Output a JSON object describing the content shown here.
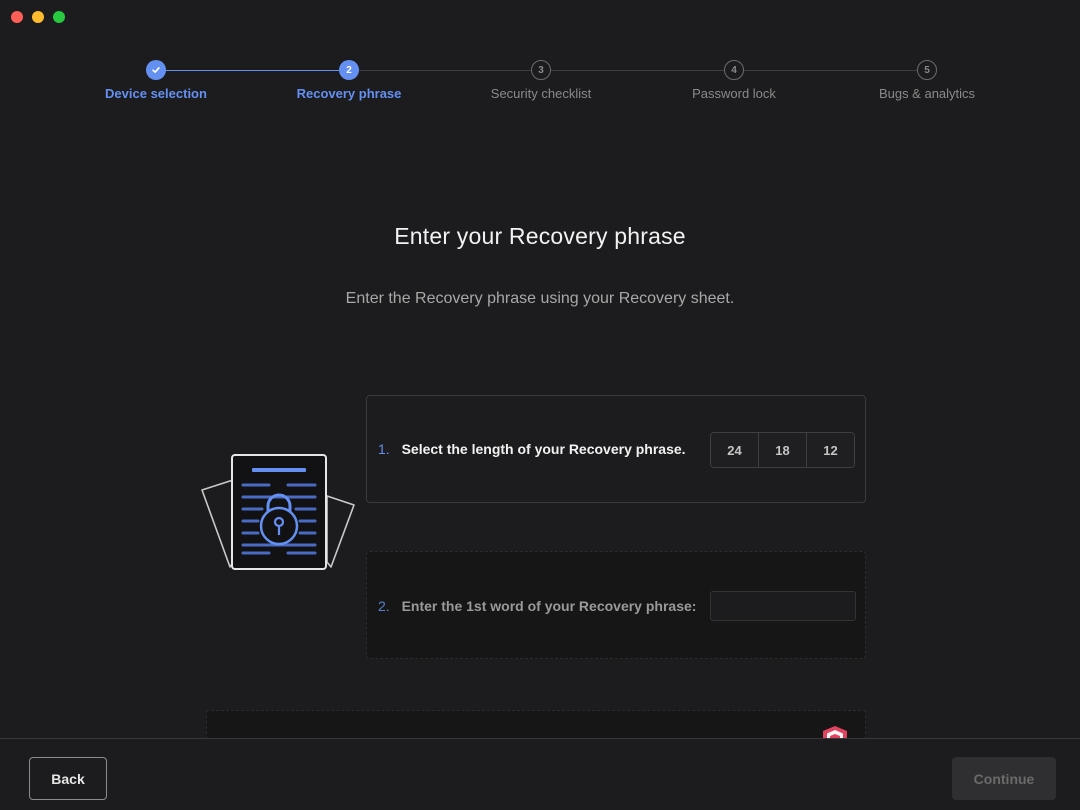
{
  "stepper": {
    "steps": [
      {
        "number": "",
        "label": "Device selection",
        "state": "done"
      },
      {
        "number": "2",
        "label": "Recovery phrase",
        "state": "active"
      },
      {
        "number": "3",
        "label": "Security checklist",
        "state": "todo"
      },
      {
        "number": "4",
        "label": "Password lock",
        "state": "todo"
      },
      {
        "number": "5",
        "label": "Bugs & analytics",
        "state": "todo"
      }
    ]
  },
  "main": {
    "title": "Enter your Recovery phrase",
    "subtitle": "Enter the Recovery phrase using your Recovery sheet."
  },
  "step_length": {
    "number": "1.",
    "label": "Select the length of your Recovery phrase.",
    "options": [
      "24",
      "18",
      "12"
    ]
  },
  "step_word": {
    "number": "2.",
    "label": "Enter the 1st word of your Recovery phrase:",
    "value": ""
  },
  "footer": {
    "back_label": "Back",
    "continue_label": "Continue"
  },
  "colors": {
    "accent": "#6490f1",
    "background": "#1c1c1e",
    "shield": "#e0435f"
  },
  "icons": {
    "check": "check-icon",
    "illustration": "recovery-sheet-lock-icon",
    "shield": "shield-icon"
  }
}
